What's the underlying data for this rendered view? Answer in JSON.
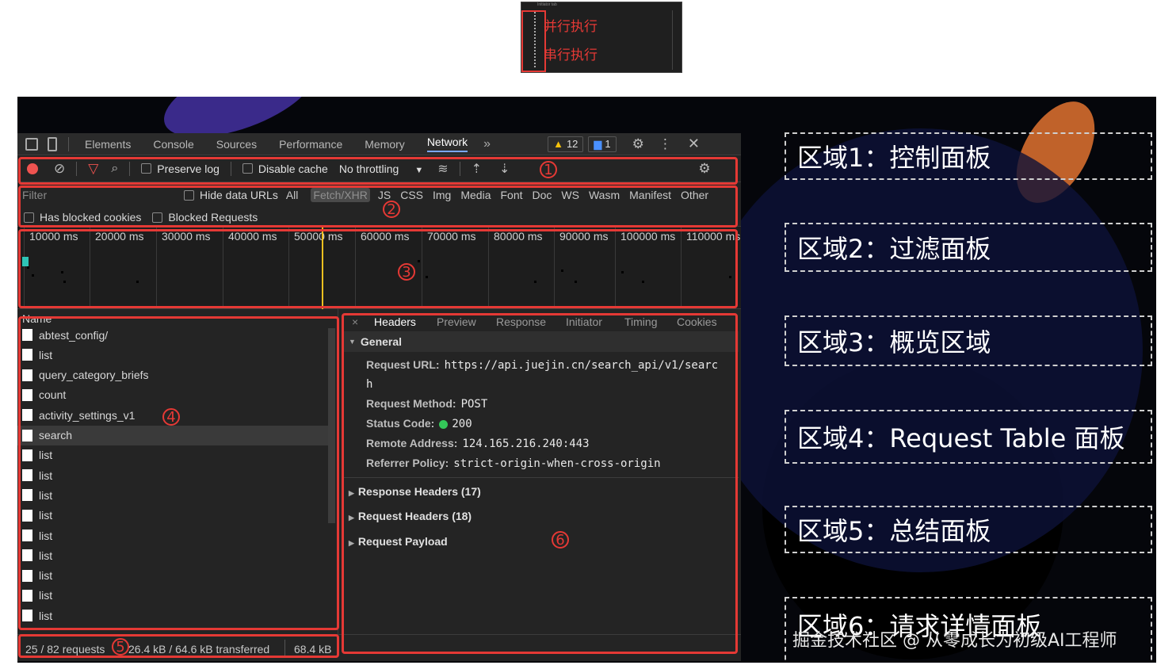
{
  "thumbnail": {
    "tiny_title": "Initiator tab",
    "lines": [
      "并行执行",
      "串行执行"
    ]
  },
  "tabs": [
    "Elements",
    "Console",
    "Sources",
    "Performance",
    "Memory",
    "Network"
  ],
  "tabs_more": "»",
  "warnings": "12",
  "messages": "1",
  "toolbar": {
    "preserve_log": "Preserve log",
    "disable_cache": "Disable cache",
    "throttling": "No throttling"
  },
  "filter": {
    "placeholder": "Filter",
    "hide_data_urls": "Hide data URLs",
    "types": [
      "All",
      "Fetch/XHR",
      "JS",
      "CSS",
      "Img",
      "Media",
      "Font",
      "Doc",
      "WS",
      "Wasm",
      "Manifest",
      "Other"
    ],
    "has_blocked_cookies": "Has blocked cookies",
    "blocked_requests": "Blocked Requests"
  },
  "overview": {
    "ticks": [
      "10000 ms",
      "20000 ms",
      "30000 ms",
      "40000 ms",
      "50000 ms",
      "60000 ms",
      "70000 ms",
      "80000 ms",
      "90000 ms",
      "100000 ms",
      "110000 ms"
    ]
  },
  "requests": {
    "header": "Name",
    "items": [
      "abtest_config/",
      "list",
      "query_category_briefs",
      "count",
      "activity_settings_v1",
      "search",
      "list",
      "list",
      "list",
      "list",
      "list",
      "list",
      "list",
      "list",
      "list"
    ]
  },
  "details": {
    "tabs": [
      "Headers",
      "Preview",
      "Response",
      "Initiator",
      "Timing",
      "Cookies"
    ],
    "close": "×",
    "general": "General",
    "request_url_label": "Request URL:",
    "request_url": "https://api.juejin.cn/search_api/v1/searc",
    "request_url_wrap": "h",
    "method_label": "Request Method:",
    "method": "POST",
    "status_label": "Status Code:",
    "status": "200",
    "remote_label": "Remote Address:",
    "remote": "124.165.216.240:443",
    "referrer_label": "Referrer Policy:",
    "referrer": "strict-origin-when-cross-origin",
    "response_headers": "Response Headers (17)",
    "request_headers": "Request Headers (18)",
    "request_payload": "Request Payload"
  },
  "summary": {
    "requests": "25 / 82 requests",
    "transferred": "26.4 kB / 64.6 kB transferred",
    "resources": "68.4 kB"
  },
  "markers": [
    "1",
    "2",
    "3",
    "4",
    "5",
    "6"
  ],
  "areas": [
    "区域1：控制面板",
    "区域2：过滤面板",
    "区域3：概览区域",
    "区域4：Request Table 面板",
    "区域5：总结面板",
    "区域6：请求详情面板"
  ],
  "watermark": "掘金技术社区 @ 从零成长为初级AI工程师",
  "colors": {
    "highlight_red": "#e53935",
    "status_green": "#34c759"
  }
}
